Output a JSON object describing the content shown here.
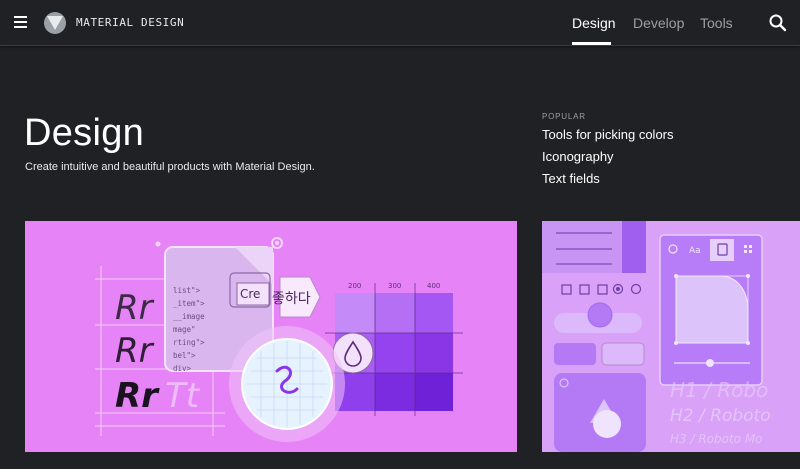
{
  "header": {
    "brand": "MATERIAL DESIGN",
    "tabs": [
      {
        "label": "Design",
        "active": true
      },
      {
        "label": "Develop",
        "active": false
      },
      {
        "label": "Tools",
        "active": false
      }
    ],
    "menu_icon": "menu-icon",
    "search_icon": "search-icon",
    "logo_icon": "material-logo-icon"
  },
  "hero": {
    "title": "Design",
    "subtitle": "Create intuitive and beautiful products with Material Design."
  },
  "popular": {
    "label": "POPULAR",
    "links": [
      "Tools for picking colors",
      "Iconography",
      "Text fields"
    ]
  },
  "card_main": {
    "type_samples": [
      "Rr",
      "Rr",
      "Rr",
      "Tt"
    ],
    "code_lines": [
      "list\">",
      "_item\">",
      "__image",
      "mage\"",
      "rting\">",
      "bel\">",
      "div>"
    ],
    "chip_text": "Cre",
    "korean_text": "좋하다",
    "scale_labels": [
      "200",
      "300",
      "400"
    ]
  },
  "card_side": {
    "toolbar_text": "Aa",
    "type_lines": [
      "H1 / Robo",
      "H2 / Roboto",
      "H3 / Roboto Mo"
    ]
  },
  "colors": {
    "background": "#202124",
    "card_main": "#e683f6",
    "card_side": "#d9a1f8",
    "accent_purple": "#8a35e6"
  }
}
